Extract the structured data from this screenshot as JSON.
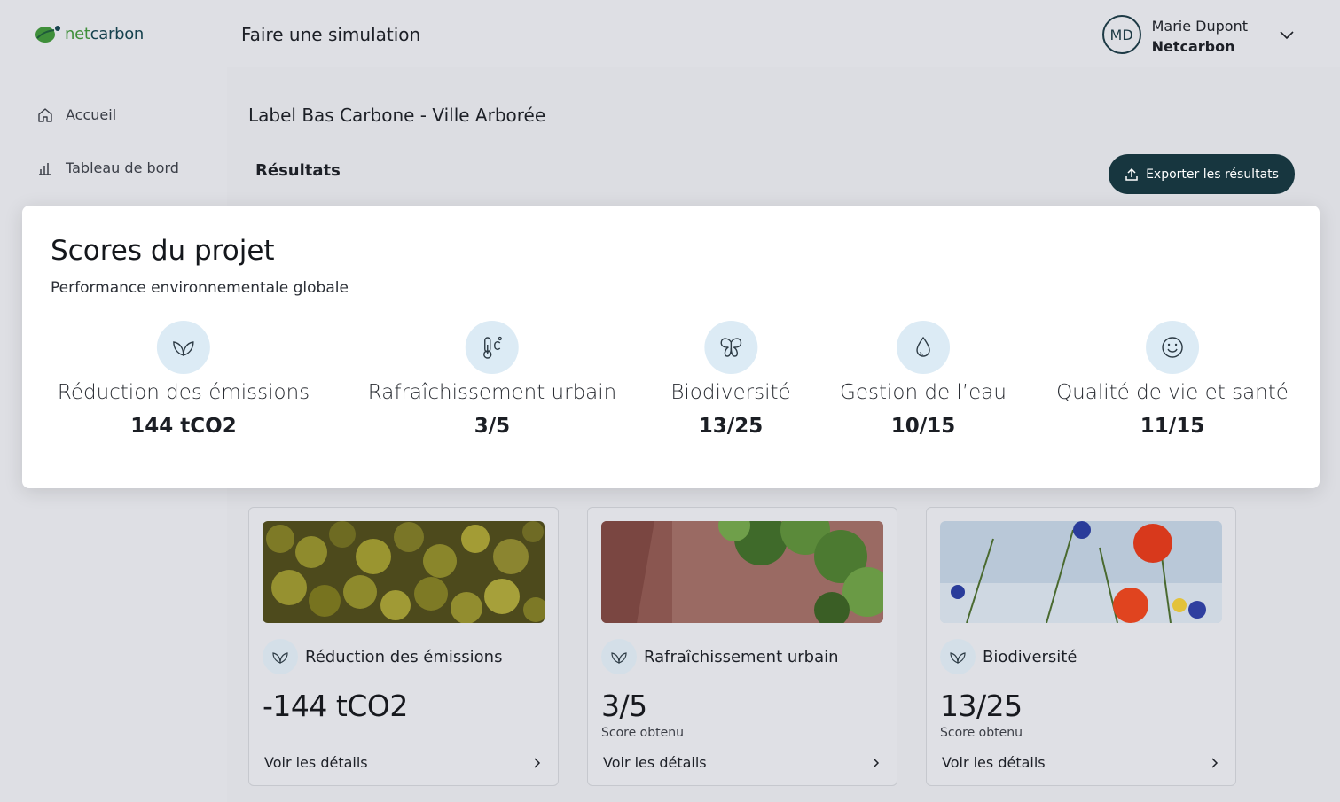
{
  "brand": {
    "name_part1": "net",
    "name_part2": "carbon"
  },
  "sidebar": {
    "items": [
      {
        "label": "Accueil",
        "icon": "home-icon"
      },
      {
        "label": "Tableau de bord",
        "icon": "chart-icon"
      }
    ]
  },
  "header": {
    "title": "Faire une simulation"
  },
  "user": {
    "initials": "MD",
    "name": "Marie Dupont",
    "org": "Netcarbon"
  },
  "project": {
    "title": "Label Bas Carbone - Ville Arborée"
  },
  "results": {
    "section_title": "Résultats",
    "export_label": "Exporter les résultats"
  },
  "scores": {
    "title": "Scores du projet",
    "subtitle": "Performance environnementale globale",
    "items": [
      {
        "label": "Réduction des émissions",
        "value": "144 tCO2",
        "icon": "leaf-icon"
      },
      {
        "label": "Rafraîchissement urbain",
        "value": "3/5",
        "icon": "thermometer-icon"
      },
      {
        "label": "Biodiversité",
        "value": "13/25",
        "icon": "butterfly-icon"
      },
      {
        "label": "Gestion de l’eau",
        "value": "10/15",
        "icon": "water-drop-icon"
      },
      {
        "label": "Qualité de vie et santé",
        "value": "11/15",
        "icon": "smile-icon"
      }
    ]
  },
  "cards": [
    {
      "label": "Réduction des émissions",
      "value": "-144 tCO2",
      "sub": "",
      "link": "Voir les détails",
      "icon": "leaf-icon"
    },
    {
      "label": "Rafraîchissement urbain",
      "value": "3/5",
      "sub": "Score obtenu",
      "link": "Voir les détails",
      "icon": "leaf-icon"
    },
    {
      "label": "Biodiversité",
      "value": "13/25",
      "sub": "Score obtenu",
      "link": "Voir les détails",
      "icon": "leaf-icon"
    }
  ],
  "colors": {
    "primary": "#17363f",
    "icon_bg": "#dcebf5",
    "leaf_green": "#3f8f3a"
  }
}
